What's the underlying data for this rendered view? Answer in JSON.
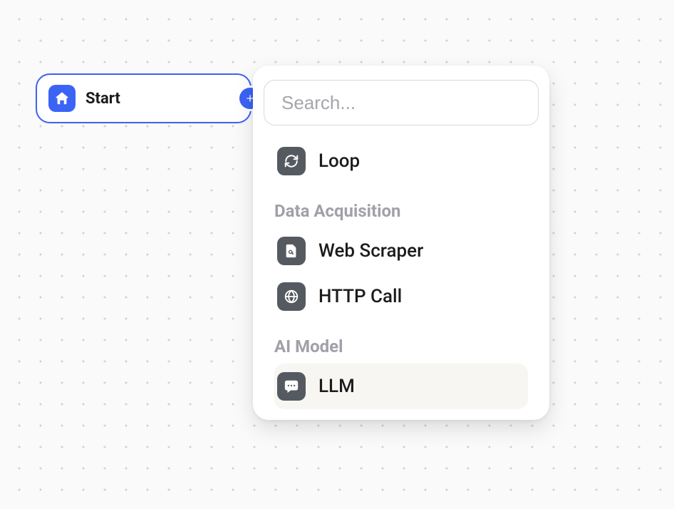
{
  "node": {
    "start_label": "Start"
  },
  "menu": {
    "search_placeholder": "Search...",
    "groups": {
      "data_acquisition": "Data Acquisition",
      "ai_model": "AI Model"
    },
    "items": {
      "loop": "Loop",
      "web_scraper": "Web Scraper",
      "http_call": "HTTP Call",
      "llm": "LLM"
    }
  }
}
